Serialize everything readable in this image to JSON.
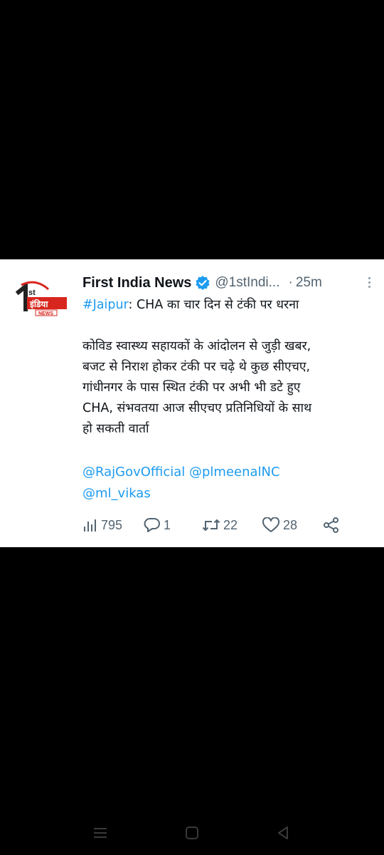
{
  "tweet": {
    "author_name": "First India News",
    "handle": "@1stIndi...",
    "separator": "·",
    "time": "25m",
    "avatar": {
      "brand_text": "इंडिया",
      "top_text": "1st",
      "sub_text": "NEWS"
    },
    "hashtag": "#Jaipur",
    "headline_rest": ": CHA का चार दिन से टंकी पर धरना",
    "body_lines": [
      "कोविड स्वास्थ्य सहायकों के आंदोलन से जुड़ी खबर,",
      "बजट से निराश होकर टंकी पर चढ़े थे कुछ सीएचए,",
      "गांधीनगर के पास स्थित टंकी पर अभी भी डटे हुए",
      "CHA, संभवतया आज सीएचए प्रतिनिधियों के साथ",
      "हो सकती वार्ता"
    ],
    "mentions": {
      "mention_1": "@RajGovOfficial",
      "mention_2": "@plmeenalNC",
      "mention_3": "@ml_vikas"
    },
    "actions": {
      "views_icon": "views-icon",
      "views": "795",
      "reply_icon": "reply-icon",
      "replies": "1",
      "retweet_icon": "retweet-icon",
      "retweets": "22",
      "like_icon": "heart-icon",
      "likes": "28",
      "share_icon": "share-icon"
    },
    "colors": {
      "link": "#1d9bf0",
      "secondary": "#536471",
      "verified": "#1d9bf0",
      "avatar_red": "#d7261e"
    }
  },
  "system_nav": {
    "recent_icon": "recent-apps-icon",
    "home_icon": "home-icon",
    "back_icon": "back-icon"
  }
}
